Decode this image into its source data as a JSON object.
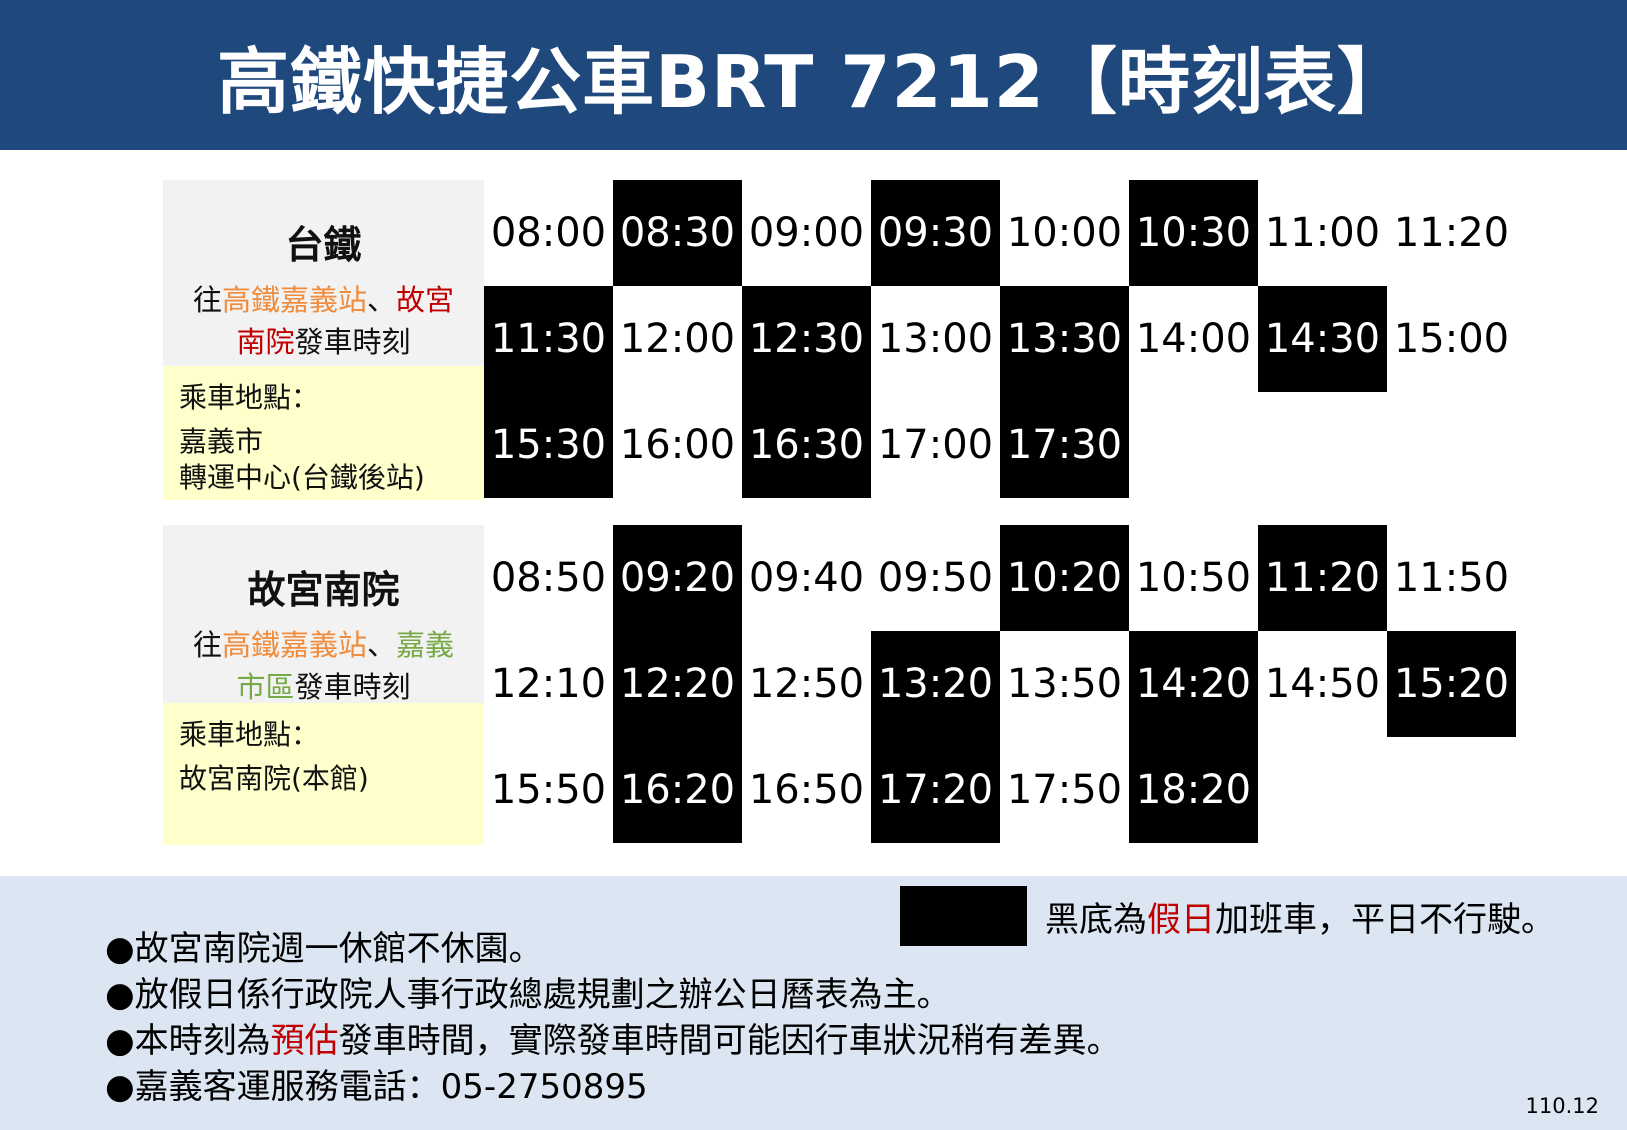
{
  "header": {
    "title": "高鐵快捷公車BRT 7212【時刻表】"
  },
  "sections": [
    {
      "title": "台鐵",
      "desc_prefix": "往",
      "desc_hl1": "高鐵嘉義站",
      "desc_mid": "、",
      "desc_hl2": "故宮",
      "desc_hl2b": "南院",
      "desc_suffix": "發車時刻",
      "boarding_label": "乘車地點：",
      "boarding_line1": "嘉義市",
      "boarding_line2": "轉運中心(台鐵後站)",
      "times": [
        [
          "08:00",
          "08:30",
          "09:00",
          "09:30",
          "10:00",
          "10:30",
          "11:00",
          "11:20"
        ],
        [
          "11:30",
          "12:00",
          "12:30",
          "13:00",
          "13:30",
          "14:00",
          "14:30",
          "15:00"
        ],
        [
          "15:30",
          "16:00",
          "16:30",
          "17:00",
          "17:30",
          "",
          "",
          ""
        ]
      ],
      "holiday": [
        [
          false,
          true,
          false,
          true,
          false,
          true,
          false,
          false
        ],
        [
          true,
          false,
          true,
          false,
          true,
          false,
          true,
          false
        ],
        [
          true,
          false,
          true,
          false,
          true,
          false,
          false,
          false
        ]
      ]
    },
    {
      "title": "故宮南院",
      "desc_prefix": "往",
      "desc_hl1": "高鐵嘉義站",
      "desc_mid": "、",
      "desc_hl2": "嘉義",
      "desc_hl2b": "市區",
      "desc_suffix": "發車時刻",
      "boarding_label": "乘車地點：",
      "boarding_line1": "故宮南院(本館)",
      "boarding_line2": "",
      "times": [
        [
          "08:50",
          "09:20",
          "09:40",
          "09:50",
          "10:20",
          "10:50",
          "11:20",
          "11:50"
        ],
        [
          "12:10",
          "12:20",
          "12:50",
          "13:20",
          "13:50",
          "14:20",
          "14:50",
          "15:20"
        ],
        [
          "15:50",
          "16:20",
          "16:50",
          "17:20",
          "17:50",
          "18:20",
          "",
          ""
        ]
      ],
      "holiday": [
        [
          false,
          true,
          false,
          false,
          true,
          false,
          true,
          false
        ],
        [
          false,
          true,
          false,
          true,
          false,
          true,
          false,
          true
        ],
        [
          false,
          true,
          false,
          true,
          false,
          true,
          false,
          false
        ]
      ]
    }
  ],
  "legend": {
    "text_prefix": "黑底為",
    "text_highlight": "假日",
    "text_suffix": "加班車，平日不行駛。"
  },
  "notes": [
    {
      "prefix": "●故宮南院週一休館不休園。",
      "highlight": "",
      "suffix": ""
    },
    {
      "prefix": "●放假日係行政院人事行政總處規劃之辦公日曆表為主。",
      "highlight": "",
      "suffix": ""
    },
    {
      "prefix": "●本時刻為",
      "highlight": "預估",
      "suffix": "發車時間，實際發車時間可能因行車狀況稍有差異。"
    },
    {
      "prefix": "●嘉義客運服務電話：05-2750895",
      "highlight": "",
      "suffix": ""
    }
  ],
  "version": "110.12",
  "colors": {
    "header_bg": "#1f497d",
    "holiday_bg": "#000000",
    "footer_bg": "#dce6f2",
    "label_bg": "#f2f2f2",
    "boarding_bg": "#ffffcc",
    "red": "#c00000",
    "orange": "#f08c3c",
    "green": "#76a947"
  }
}
